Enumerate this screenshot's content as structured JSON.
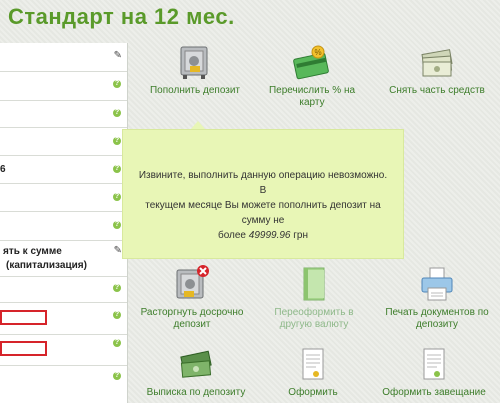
{
  "title": "Стандарт на 12 мес.",
  "form": {
    "row_capitalization_line1": "ять к сумме",
    "row_capitalization_line2": "(капитализация)",
    "row_short": "6"
  },
  "actions": {
    "top_up": "Пополнить депозит",
    "transfer_line1": "Перечислить % на",
    "transfer_line2": "карту",
    "withdraw": "Снять часть средств",
    "terminate_line1": "Расторгнуть досрочно",
    "terminate_line2": "депозит",
    "reissue_line1": "Переоформить в",
    "reissue_line2": "другую валюту",
    "print_line1": "Печать документов по",
    "print_line2": "депозиту",
    "statement": "Выписка по депозиту",
    "issue": "Оформить",
    "will": "Оформить завещание"
  },
  "tooltip": {
    "line1": "Извините, выполнить данную операцию невозможно. В",
    "line2": "текущем месяце Вы можете пополнить депозит на сумму не",
    "line3_prefix": "более ",
    "amount": "49999.96",
    "currency": " грн"
  },
  "colors": {
    "accent": "#5a9a2a",
    "link": "#3d7d2a",
    "error": "#d6242a",
    "tooltip": "#e8f6b6"
  }
}
